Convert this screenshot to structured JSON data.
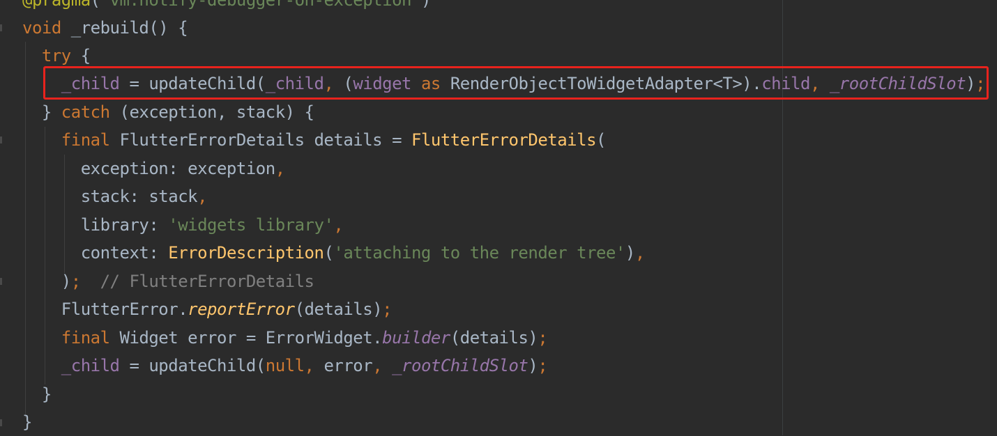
{
  "lines": [
    [
      {
        "t": "@pragma",
        "c": "ann"
      },
      {
        "t": "(",
        "c": "plain"
      },
      {
        "t": "'vm:notify-debugger-on-exception'",
        "c": "str"
      },
      {
        "t": ")",
        "c": "plain"
      }
    ],
    [
      {
        "t": "void ",
        "c": "kw"
      },
      {
        "t": "_rebuild() {",
        "c": "plain"
      }
    ],
    [
      {
        "t": "  try ",
        "c": "kw"
      },
      {
        "t": "{",
        "c": "plain"
      }
    ],
    [
      {
        "t": "    _child",
        "c": "fld"
      },
      {
        "t": " = updateChild(",
        "c": "plain"
      },
      {
        "t": "_child",
        "c": "fld"
      },
      {
        "t": ", ",
        "c": "kw"
      },
      {
        "t": "(",
        "c": "plain"
      },
      {
        "t": "widget ",
        "c": "fld"
      },
      {
        "t": "as ",
        "c": "kw"
      },
      {
        "t": "RenderObjectToWidgetAdapter<T>).",
        "c": "plain"
      },
      {
        "t": "child",
        "c": "fld"
      },
      {
        "t": ", ",
        "c": "kw"
      },
      {
        "t": "_rootChildSlot",
        "c": "static-ital"
      },
      {
        "t": ")",
        "c": "plain"
      },
      {
        "t": ";",
        "c": "kw"
      }
    ],
    [
      {
        "t": "  } ",
        "c": "plain"
      },
      {
        "t": "catch ",
        "c": "kw"
      },
      {
        "t": "(exception, stack) {",
        "c": "plain"
      }
    ],
    [
      {
        "t": "    final ",
        "c": "kw"
      },
      {
        "t": "FlutterErrorDetails details = ",
        "c": "plain"
      },
      {
        "t": "FlutterErrorDetails",
        "c": "fn"
      },
      {
        "t": "(",
        "c": "plain"
      }
    ],
    [
      {
        "t": "      exception: exception",
        "c": "plain"
      },
      {
        "t": ",",
        "c": "kw"
      }
    ],
    [
      {
        "t": "      stack: stack",
        "c": "plain"
      },
      {
        "t": ",",
        "c": "kw"
      }
    ],
    [
      {
        "t": "      library: ",
        "c": "plain"
      },
      {
        "t": "'widgets library'",
        "c": "str"
      },
      {
        "t": ",",
        "c": "kw"
      }
    ],
    [
      {
        "t": "      context: ",
        "c": "plain"
      },
      {
        "t": "ErrorDescription",
        "c": "fn"
      },
      {
        "t": "(",
        "c": "plain"
      },
      {
        "t": "'attaching to the render tree'",
        "c": "str"
      },
      {
        "t": ")",
        "c": "plain"
      },
      {
        "t": ",",
        "c": "kw"
      }
    ],
    [
      {
        "t": "    )",
        "c": "plain"
      },
      {
        "t": ";  ",
        "c": "kw"
      },
      {
        "t": "// FlutterErrorDetails",
        "c": "cmt"
      }
    ],
    [
      {
        "t": "    FlutterError.",
        "c": "plain"
      },
      {
        "t": "reportError",
        "c": "fn-ital"
      },
      {
        "t": "(details)",
        "c": "plain"
      },
      {
        "t": ";",
        "c": "kw"
      }
    ],
    [
      {
        "t": "    final ",
        "c": "kw"
      },
      {
        "t": "Widget error = ErrorWidget.",
        "c": "plain"
      },
      {
        "t": "builder",
        "c": "static-ital"
      },
      {
        "t": "(details)",
        "c": "plain"
      },
      {
        "t": ";",
        "c": "kw"
      }
    ],
    [
      {
        "t": "    _child",
        "c": "fld"
      },
      {
        "t": " = updateChild(",
        "c": "plain"
      },
      {
        "t": "null",
        "c": "kw"
      },
      {
        "t": ", ",
        "c": "kw"
      },
      {
        "t": "error",
        "c": "plain"
      },
      {
        "t": ", ",
        "c": "kw"
      },
      {
        "t": "_rootChildSlot",
        "c": "static-ital"
      },
      {
        "t": ")",
        "c": "plain"
      },
      {
        "t": ";",
        "c": "kw"
      }
    ],
    [
      {
        "t": "  }",
        "c": "plain"
      }
    ],
    [
      {
        "t": "}",
        "c": "plain"
      }
    ]
  ],
  "colors": {
    "background": "#2b2b2b",
    "keyword": "#cc7832",
    "string": "#6a8759",
    "field": "#9876aa",
    "function": "#ffc66d",
    "comment": "#808080",
    "text": "#a9b7c6",
    "highlight_box": "#e8231d"
  }
}
